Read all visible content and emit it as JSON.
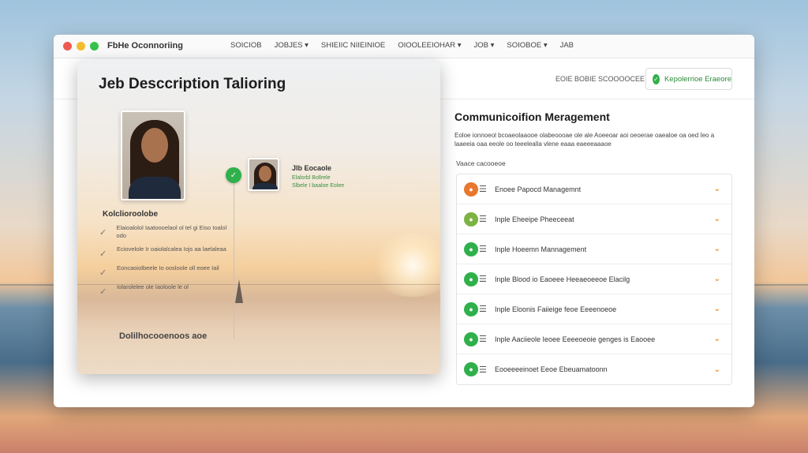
{
  "app": {
    "title": "FbHe Oconnoriing"
  },
  "nav": [
    {
      "label": "SOICIOB"
    },
    {
      "label": "JOBJES ▾"
    },
    {
      "label": "SHIEIIC NIIEINIOE"
    },
    {
      "label": "OIOOLEEIOHAR ▾"
    },
    {
      "label": "JOB ▾"
    },
    {
      "label": "SOIOBOE ▾"
    },
    {
      "label": "JAB"
    }
  ],
  "header": {
    "status_text": "EOIE BOBIE SCOOOOCEE",
    "action_button": "Kepolerrioe Eraeore"
  },
  "left_panel": {
    "title": "Jeb Desccription Talioring",
    "candidate_name": "Jlb Eocaole",
    "candidate_meta": [
      "Elalorbl Bollrele",
      "Slbele I baaloe Eolee"
    ],
    "section_label": "Kolclioroolobe",
    "bullets": [
      "Elaioalolol Iaatoooelaol ol tel gi Eiso Ioalol odo",
      "Eciovelole Ir oaiolalcalea Iojs aa laelaleaa",
      "Eoncaoiolbeele Io oosloole oll eoee Iail",
      "Iolarolelee ole Iaoloole le ol"
    ],
    "footer": "Dolilhocooenoos aoe"
  },
  "right_panel": {
    "title": "Communicoifion Meragement",
    "description": "Eoloe ionnoeol bcoaeolaaooe olabeoooae ole ale Aoeeoar aoi oeoerae oaealoe oa oed Ieo a laaeeia oaa eeole oo teeelealla vlene eaaa eaeeeaaaoe",
    "subhead": "Vaace cacooeoe",
    "items": [
      {
        "label": "Enoee Papocd Managemnt",
        "color": "#e7782c"
      },
      {
        "label": "Inple Eheeipe Pheeceeat",
        "color": "#7cb342"
      },
      {
        "label": "Inple Hoeemn Mannagement",
        "color": "#2fb04b"
      },
      {
        "label": "Inple Blood io Eaoeee Heeaeoeeoe Elacilg",
        "color": "#2fb04b"
      },
      {
        "label": "Inple Eloonis Faiieige feoe Eeeenoeoe",
        "color": "#2fb04b"
      },
      {
        "label": "Inple Aaciieole Ieoee Eeeeoeoie genges is Eaooee",
        "color": "#2fb04b"
      },
      {
        "label": "Eooeeeeinoet Eeoe Ebeuamatoonn",
        "color": "#2fb04b"
      }
    ]
  }
}
